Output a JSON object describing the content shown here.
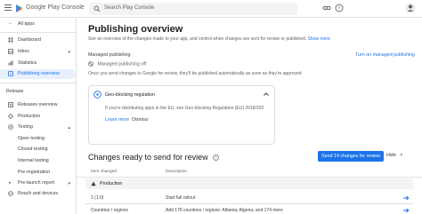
{
  "colors": {
    "accent": "#1a73e8",
    "active_bg": "#e8f0fe",
    "border": "#e0e0e0"
  },
  "header": {
    "app_title": "Google Play Console",
    "search_placeholder": "Search Play Console",
    "icons": [
      "menu-icon",
      "play-console-logo",
      "search-icon",
      "link-icon",
      "help-icon",
      "account-icon"
    ]
  },
  "sidebar": {
    "all_apps": "All apps",
    "items": [
      {
        "label": "Dashboard",
        "icon": "dashboard-icon"
      },
      {
        "label": "Inbox",
        "icon": "inbox-icon"
      },
      {
        "label": "Statistics",
        "icon": "statistics-icon"
      },
      {
        "label": "Publishing overview",
        "icon": "publishing-icon",
        "active": true
      }
    ],
    "release_heading": "Release",
    "release_items": [
      {
        "label": "Releases overview",
        "icon": "releases-icon"
      },
      {
        "label": "Production",
        "icon": "production-icon"
      },
      {
        "label": "Testing",
        "icon": "testing-icon"
      }
    ],
    "testing_subitems": [
      "Open testing",
      "Closed testing",
      "Internal testing"
    ],
    "more_items": [
      {
        "label": "Pre-registration",
        "icon": ""
      },
      {
        "label": "Pre-launch report",
        "icon": ""
      },
      {
        "label": "Reach and devices",
        "icon": "reach-icon"
      }
    ]
  },
  "main": {
    "title": "Publishing overview",
    "intro": "See an overview of the changes made to your app, and control when changes are sent for review or published.",
    "intro_link": "Show more",
    "managed_section": "Managed publishing",
    "turn_on_link": "Turn on managed publishing",
    "managed_status": "Managed publishing off",
    "managed_desc": "Once you send changes to Google for review, they'll be published automatically as soon as they're approved",
    "card": {
      "title": "Geo-blocking regulation",
      "desc": "If you're distributing apps in the EU, see Geo-blocking Regulation (EU) 2018/302",
      "learn_more": "Learn more",
      "dismiss": "Dismiss"
    },
    "changes_title": "Changes ready to send for review",
    "send_button": "Send 14 changes for review",
    "hide_label": "Hide",
    "table": {
      "headers": [
        "Item changed",
        "Description"
      ],
      "group": "Production",
      "rows": [
        {
          "item": "1 (1.0)",
          "description": "Start full rollout"
        },
        {
          "item": "Countries / regions",
          "description": "Add 176 countries / regions: Albania, Algeria, and 174 more"
        }
      ]
    }
  }
}
